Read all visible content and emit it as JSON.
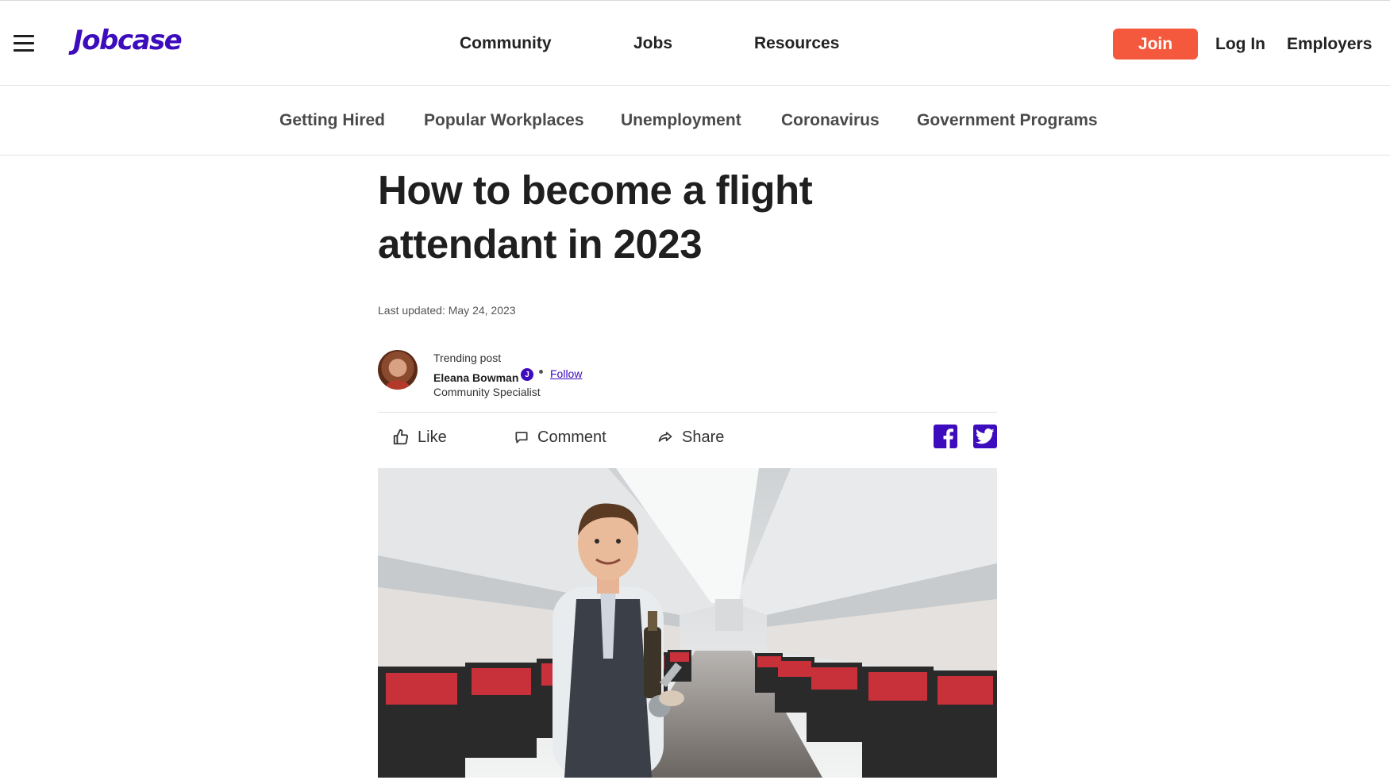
{
  "header": {
    "logo": "Jobcase",
    "nav": [
      "Community",
      "Jobs",
      "Resources"
    ],
    "join_label": "Join",
    "login_label": "Log In",
    "employers_label": "Employers"
  },
  "subnav": [
    "Getting Hired",
    "Popular Workplaces",
    "Unemployment",
    "Coronavirus",
    "Government Programs"
  ],
  "article": {
    "title": "How to become a flight attendant in 2023",
    "last_updated": "Last updated: May 24, 2023",
    "author": {
      "trending": "Trending post",
      "name": "Eleana Bowman",
      "follow": "Follow",
      "role": "Community Specialist"
    },
    "actions": {
      "like": "Like",
      "comment": "Comment",
      "share": "Share"
    },
    "hero_alt": "Smiling flight attendant holding a bottle and glasses in an airplane aisle with red seats"
  },
  "colors": {
    "brand": "#3d0cbd",
    "join": "#f4593d",
    "seat_red": "#c8303a"
  }
}
